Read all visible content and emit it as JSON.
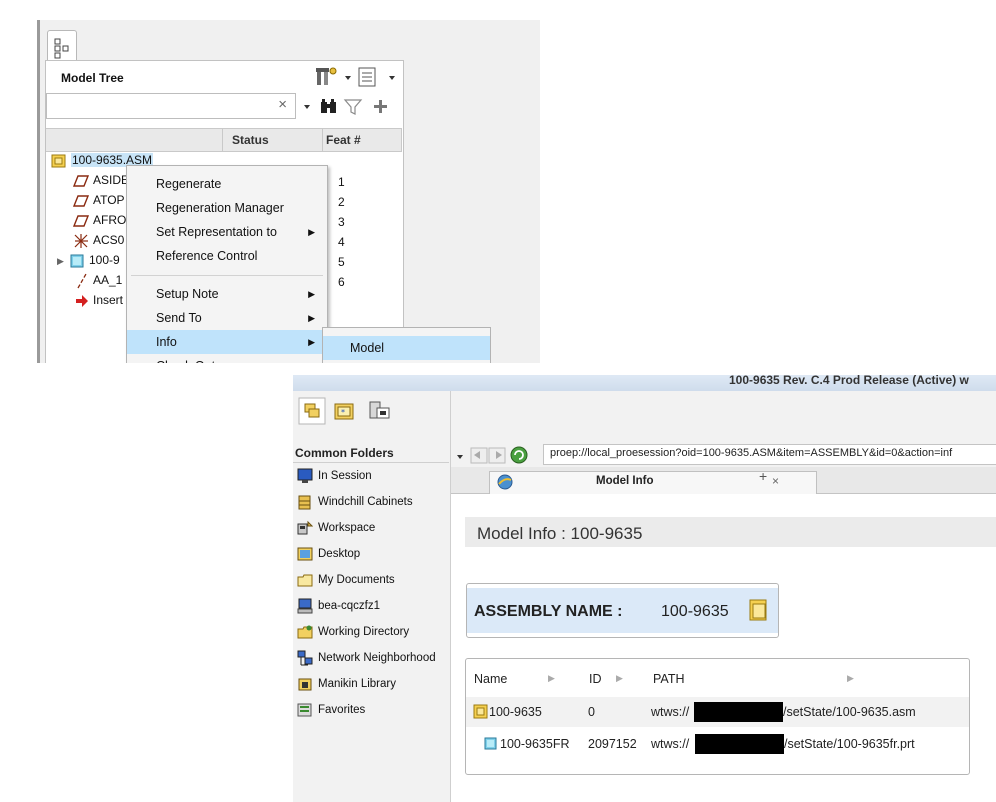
{
  "model_tree": {
    "title": "Model Tree",
    "search_placeholder": "",
    "columns": {
      "status": "Status",
      "feat": "Feat #"
    },
    "rows": [
      {
        "label": "100-9635.ASM",
        "feat": "",
        "icon": "assembly-icon"
      },
      {
        "label": "ASIDE",
        "feat": "1",
        "icon": "datum-plane-icon"
      },
      {
        "label": "ATOP",
        "feat": "2",
        "icon": "datum-plane-icon"
      },
      {
        "label": "AFRO",
        "feat": "3",
        "icon": "datum-plane-icon"
      },
      {
        "label": "ACS0",
        "feat": "4",
        "icon": "coordinate-system-icon"
      },
      {
        "label": "100-9",
        "feat": "5",
        "icon": "part-icon"
      },
      {
        "label": "AA_1",
        "feat": "6",
        "icon": "datum-axis-icon"
      },
      {
        "label": "Insert",
        "feat": "",
        "icon": "insert-here-arrow-icon"
      }
    ]
  },
  "context_menu": {
    "items": [
      {
        "label": "Regenerate",
        "has_submenu": false
      },
      {
        "label": "Regeneration Manager",
        "has_submenu": false
      },
      {
        "label": "Set Representation to",
        "has_submenu": true
      },
      {
        "label": "Reference Control",
        "has_submenu": false
      },
      {
        "label": "Setup Note",
        "has_submenu": true
      },
      {
        "label": "Send To",
        "has_submenu": true
      },
      {
        "label": "Info",
        "has_submenu": true,
        "highlighted": true
      },
      {
        "label": "Check Out",
        "has_submenu": false
      }
    ],
    "submenu": {
      "items": [
        "Model"
      ]
    }
  },
  "window": {
    "title": "100-9635 Rev. C.4 Prod Release (Active) w"
  },
  "navigator": {
    "heading": "Common Folders",
    "items": [
      {
        "label": "In Session",
        "icon": "monitor-icon"
      },
      {
        "label": "Windchill Cabinets",
        "icon": "cabinet-icon"
      },
      {
        "label": "Workspace",
        "icon": "workspace-icon"
      },
      {
        "label": "Desktop",
        "icon": "desktop-icon"
      },
      {
        "label": "My Documents",
        "icon": "documents-folder-icon"
      },
      {
        "label": "bea-cqczfz1",
        "icon": "computer-icon"
      },
      {
        "label": "Working Directory",
        "icon": "working-folder-icon"
      },
      {
        "label": "Network Neighborhood",
        "icon": "network-icon"
      },
      {
        "label": "Manikin Library",
        "icon": "library-icon"
      },
      {
        "label": "Favorites",
        "icon": "favorites-icon"
      }
    ]
  },
  "browser": {
    "address": "proep://local_proesession?oid=100-9635.ASM&item=ASSEMBLY&id=0&action=inf",
    "tab_label": "Model Info",
    "tab_close": "×",
    "tab_new": "+"
  },
  "model_info": {
    "title": "Model Info : 100-9635",
    "assembly_label": "ASSEMBLY NAME :",
    "assembly_value": "100-9635",
    "table": {
      "headers": [
        "Name",
        "ID",
        "PATH"
      ],
      "rows": [
        {
          "name": "100-9635",
          "id": "0",
          "path_prefix": "wtws://",
          "path_suffix": "/setState/100-9635.asm",
          "icon": "assembly-icon"
        },
        {
          "name": "100-9635FR",
          "id": "2097152",
          "path_prefix": "wtws://",
          "path_suffix": "/setState/100-9635fr.prt",
          "icon": "part-icon"
        }
      ]
    }
  },
  "colors": {
    "highlight": "#bfe3fb",
    "assembly_box": "#dbe9f8",
    "title_bar": "#ebebeb"
  }
}
